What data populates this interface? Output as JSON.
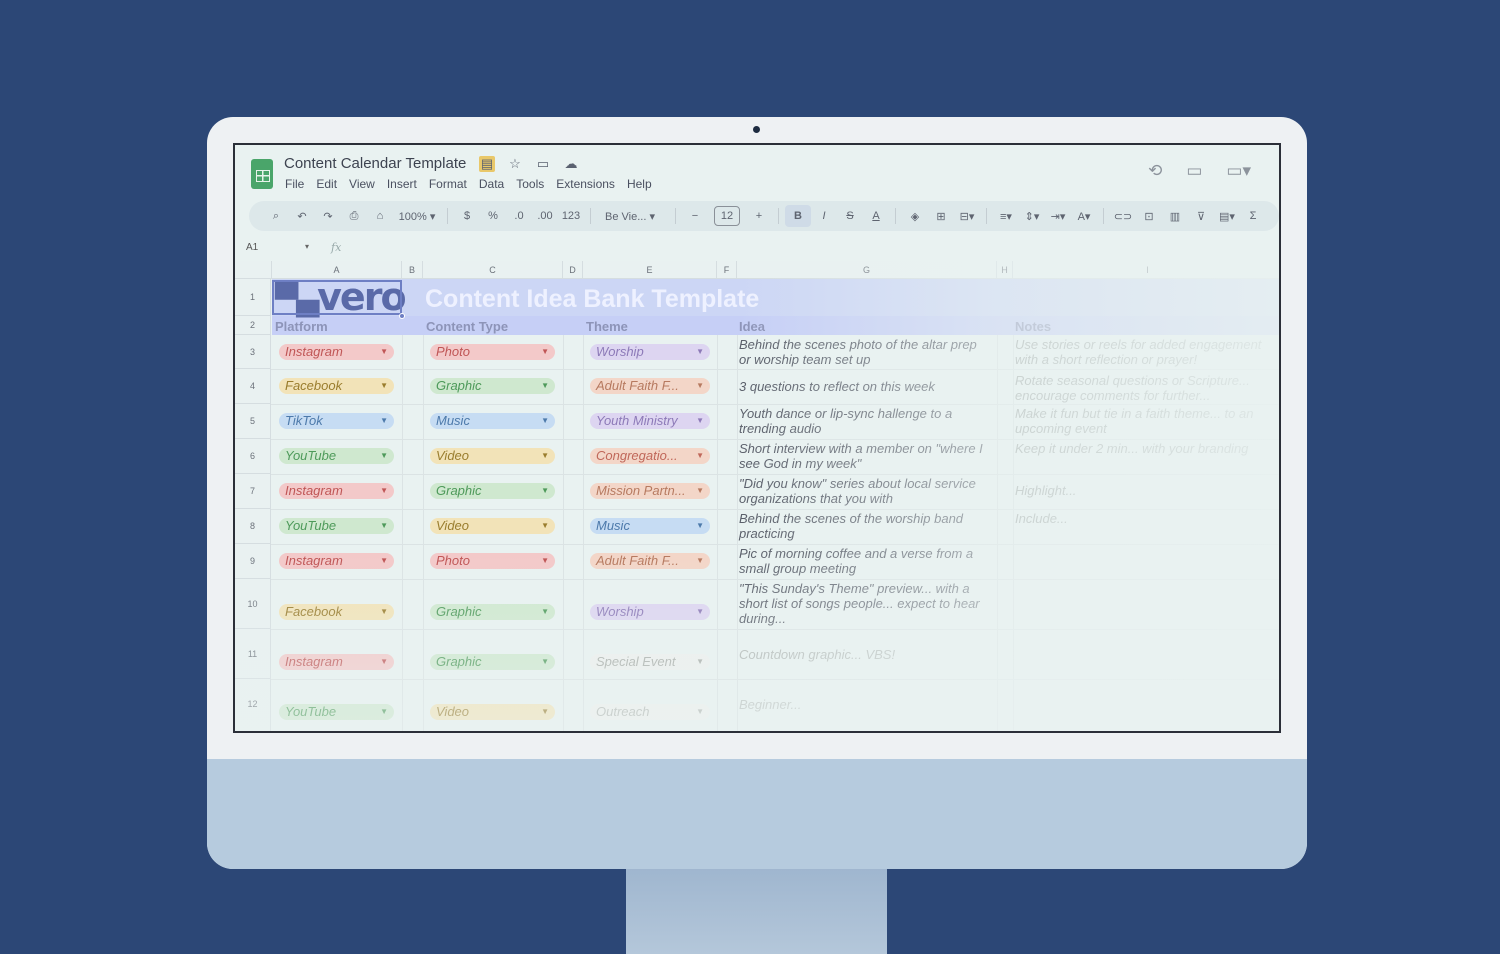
{
  "app": {
    "doc_title": "Content Calendar Template",
    "menu": [
      "File",
      "Edit",
      "View",
      "Insert",
      "Format",
      "Data",
      "Tools",
      "Extensions",
      "Help"
    ]
  },
  "toolbar": {
    "zoom": "100%",
    "currency": "$",
    "percent": "%",
    "decimal_decrease": ".0",
    "decimal_increase": ".00",
    "format_123": "123",
    "font": "Be Vie...",
    "font_size": "12",
    "bold": "B",
    "italic": "I"
  },
  "formula_bar": {
    "cell_ref": "A1",
    "fx": "fx"
  },
  "grid": {
    "columns": [
      "A",
      "B",
      "C",
      "D",
      "E",
      "F",
      "G",
      "H",
      "I"
    ],
    "rows": [
      "1",
      "2",
      "3",
      "4",
      "5",
      "6",
      "7",
      "8",
      "9",
      "10",
      "11",
      "12"
    ]
  },
  "sheet": {
    "logo_text": "vero",
    "title": "Content Idea Bank Template",
    "headers": {
      "platform": "Platform",
      "content_type": "Content Type",
      "theme": "Theme",
      "idea": "Idea",
      "notes": "Notes"
    },
    "rows": [
      {
        "platform": "Instagram",
        "content_type": "Photo",
        "theme": "Worship",
        "idea": "Behind the scenes photo of the altar prep or worship team set up",
        "notes": "Use stories or reels for added engagement with a short reflection or prayer!"
      },
      {
        "platform": "Facebook",
        "content_type": "Graphic",
        "theme": "Adult Faith F...",
        "idea": "3 questions to reflect on this week",
        "notes": "Rotate seasonal questions or Scripture... encourage comments for further..."
      },
      {
        "platform": "TikTok",
        "content_type": "Music",
        "theme": "Youth Ministry",
        "idea": "Youth dance or lip-sync hallenge to a trending audio",
        "notes": "Make it fun but tie in a faith theme... to an upcoming event"
      },
      {
        "platform": "YouTube",
        "content_type": "Video",
        "theme": "Congregatio...",
        "idea": "Short interview with a member on \"where I see God in my week\"",
        "notes": "Keep it under 2 min... with your branding"
      },
      {
        "platform": "Instagram",
        "content_type": "Graphic",
        "theme": "Mission Partn...",
        "idea": "\"Did you know\" series about local service organizations that you  with",
        "notes": "Highlight..."
      },
      {
        "platform": "YouTube",
        "content_type": "Video",
        "theme": "Music",
        "idea": "Behind the scenes of the worship band practicing",
        "notes": "Include..."
      },
      {
        "platform": "Instagram",
        "content_type": "Photo",
        "theme": "Adult Faith F...",
        "idea": "Pic of morning coffee and a verse from a small group meeting",
        "notes": ""
      },
      {
        "platform": "Facebook",
        "content_type": "Graphic",
        "theme": "Worship",
        "idea": "\"This Sunday's Theme\" preview... with a short list of songs people... expect to hear during...",
        "notes": ""
      },
      {
        "platform": "Instagram",
        "content_type": "Graphic",
        "theme": "Special Event",
        "idea": "Countdown graphic... VBS!",
        "notes": ""
      },
      {
        "platform": "YouTube",
        "content_type": "Video",
        "theme": "Outreach",
        "idea": "Beginner...",
        "notes": ""
      }
    ]
  },
  "colors": {
    "background": "#2c4776",
    "header_band": "#c6cff6",
    "chip_red": "#f3c9c9",
    "chip_yellow": "#f2e3b8",
    "chip_blue": "#c6dcf3",
    "chip_green": "#cfe8cf",
    "chip_purple": "#ddd5f1",
    "chip_orange": "#f3d6c8"
  }
}
